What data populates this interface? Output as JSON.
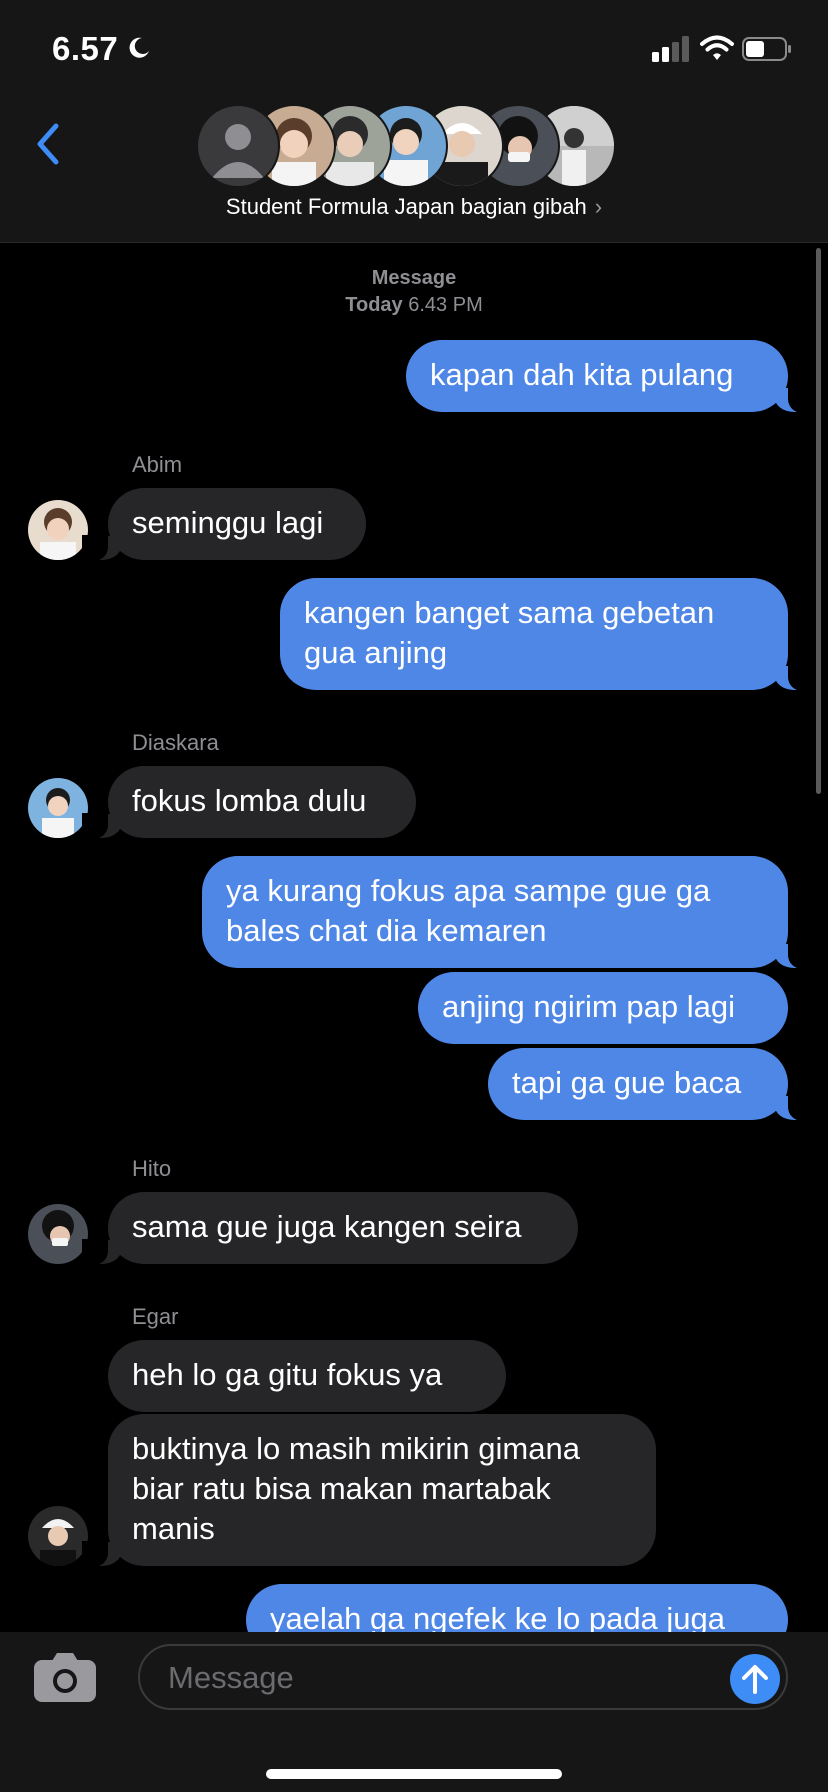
{
  "status": {
    "time": "6.57",
    "moon_icon": "moon-icon",
    "signal_icon": "signal-icon",
    "wifi_icon": "wifi-icon",
    "battery_icon": "battery-icon"
  },
  "header": {
    "group_name": "Student Formula Japan bagian gibah",
    "chevron": "›",
    "back_icon": "chevron-left-icon"
  },
  "thread": {
    "timestamp_label": "Message",
    "timestamp_day": "Today",
    "timestamp_time": "6.43 PM"
  },
  "messages": [
    {
      "side": "out",
      "text": "kapan dah kita pulang"
    },
    {
      "side": "in",
      "sender": "Abim",
      "text": "seminggu lagi"
    },
    {
      "side": "out",
      "text": "kangen banget sama gebetan gua anjing"
    },
    {
      "side": "in",
      "sender": "Diaskara",
      "text": "fokus lomba dulu"
    },
    {
      "side": "out",
      "text": "ya kurang fokus apa sampe gue ga bales chat dia kemaren"
    },
    {
      "side": "out",
      "text": "anjing ngirim pap lagi"
    },
    {
      "side": "out",
      "text": "tapi ga gue baca"
    },
    {
      "side": "in",
      "sender": "Hito",
      "text": "sama gue juga kangen seira"
    },
    {
      "side": "in",
      "sender": "Egar",
      "text": "heh lo ga gitu fokus ya"
    },
    {
      "side": "in",
      "text": "buktinya lo masih mikirin gimana biar ratu bisa makan martabak manis"
    },
    {
      "side": "out",
      "text": "yaelah ga ngefek ke lo pada juga"
    }
  ],
  "input": {
    "placeholder": "Message",
    "camera_icon": "camera-icon",
    "send_icon": "arrow-up-icon"
  },
  "colors": {
    "outgoing": "#4f87e6",
    "incoming": "#262628",
    "accent": "#3e8cf6",
    "background": "#000000"
  }
}
